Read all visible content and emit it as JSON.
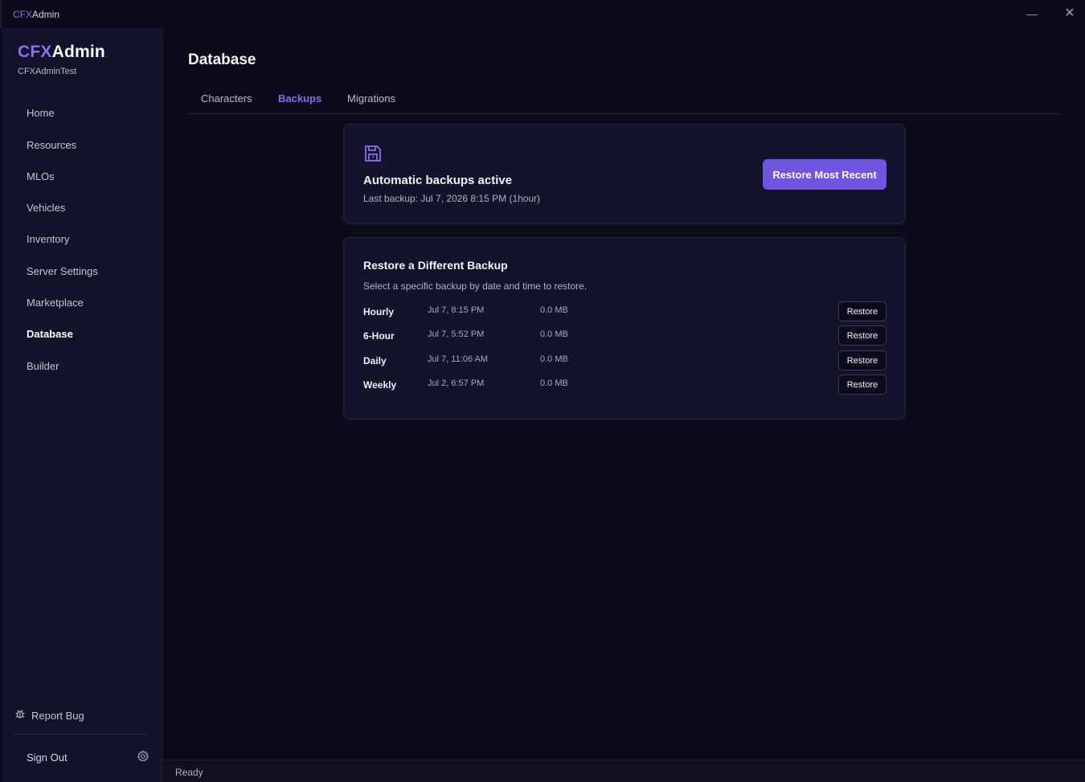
{
  "window": {
    "title_accent": "CFX",
    "title_rest": "Admin",
    "minimize_glyph": "—",
    "close_glyph": "✕"
  },
  "sidebar": {
    "brand_accent": "CFX",
    "brand_rest": "Admin",
    "server_name": "CFXAdminTest",
    "items": [
      {
        "label": "Home"
      },
      {
        "label": "Resources"
      },
      {
        "label": "MLOs"
      },
      {
        "label": "Vehicles"
      },
      {
        "label": "Inventory"
      },
      {
        "label": "Server Settings"
      },
      {
        "label": "Marketplace"
      },
      {
        "label": "Database",
        "active": true
      },
      {
        "label": "Builder"
      }
    ],
    "report_bug": "Report Bug",
    "sign_out": "Sign Out"
  },
  "main": {
    "title": "Database",
    "tabs": [
      {
        "label": "Characters"
      },
      {
        "label": "Backups",
        "active": true
      },
      {
        "label": "Migrations"
      }
    ],
    "status_card": {
      "title": "Automatic backups active",
      "last_backup": "Last backup: Jul 7, 2026 8:15 PM (1hour)",
      "restore_recent_label": "Restore Most Recent"
    },
    "restore_card": {
      "title": "Restore a Different Backup",
      "description": "Select a specific backup by date and time to restore.",
      "rows": [
        {
          "type": "Hourly",
          "date": "Jul 7, 8:15 PM",
          "size": "0.0 MB",
          "action": "Restore"
        },
        {
          "type": "6-Hour",
          "date": "Jul 7, 5:52 PM",
          "size": "0.0 MB",
          "action": "Restore"
        },
        {
          "type": "Daily",
          "date": "Jul 7, 11:06 AM",
          "size": "0.0 MB",
          "action": "Restore"
        },
        {
          "type": "Weekly",
          "date": "Jul 2, 6:57 PM",
          "size": "0.0 MB",
          "action": "Restore"
        }
      ]
    }
  },
  "statusbar": {
    "text": "Ready"
  },
  "colors": {
    "accent": "#8b6df0",
    "primary_button": "#7055e4",
    "background": "#0c0b1b",
    "sidebar": "#12122a",
    "card": "#13132b"
  },
  "icons": {
    "save": "floppy-disk-icon",
    "bug": "bug-icon",
    "settings": "gear-icon"
  }
}
